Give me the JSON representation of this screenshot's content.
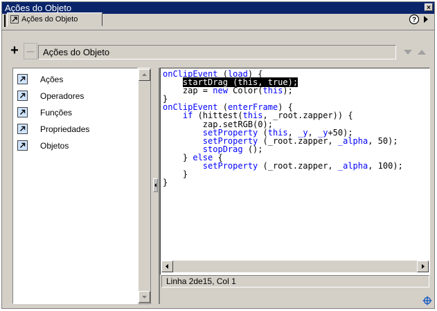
{
  "window": {
    "title": "Ações do Objeto",
    "close_glyph": "×"
  },
  "tab": {
    "label": "Ações do Objeto",
    "icon": "arrow-icon"
  },
  "toolbar": {
    "add_label": "+",
    "remove_label": "–",
    "field_label": "Ações do Objeto"
  },
  "tree": {
    "items": [
      {
        "label": "Ações",
        "icon": "arrow-icon"
      },
      {
        "label": "Operadores",
        "icon": "arrow-icon"
      },
      {
        "label": "Funções",
        "icon": "arrow-icon"
      },
      {
        "label": "Propriedades",
        "icon": "arrow-icon"
      },
      {
        "label": "Objetos",
        "icon": "arrow-icon"
      }
    ]
  },
  "code": {
    "lines": [
      "onClipEvent (load) {",
      "    startDrag (this, true);",
      "    zap = new Color(this);",
      "}",
      "onClipEvent (enterFrame) {",
      "    if (hittest(this, _root.zapper)) {",
      "        zap.setRGB(0);",
      "        setProperty (this, _y, _y+50);",
      "        setProperty (_root.zapper, _alpha, 50);",
      "        stopDrag ();",
      "    } else {",
      "        setProperty (_root.zapper, _alpha, 100);",
      "    }",
      "}"
    ],
    "highlighted_line": 2
  },
  "status": {
    "text": "Linha 2de15, Col 1"
  },
  "colors": {
    "titlebar": "#0a246a",
    "keyword": "#0000ff",
    "panel": "#d4d0c8"
  }
}
